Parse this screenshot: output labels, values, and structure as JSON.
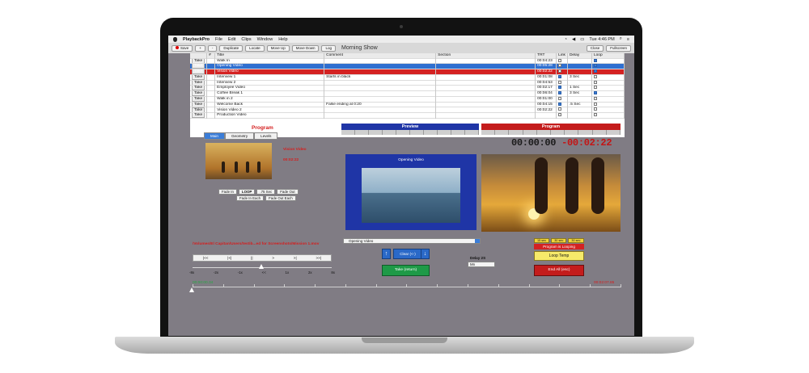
{
  "menubar": {
    "app": "PlaybackPro",
    "items": [
      "File",
      "Edit",
      "Clips",
      "Window",
      "Help"
    ],
    "clock": "Tue 4:46 PM"
  },
  "toolbar": {
    "save": "Save",
    "add": "+",
    "remove": "-",
    "duplicate": "Duplicate",
    "locate": "Locate",
    "move_up": "Move Up",
    "move_down": "Move Down",
    "log": "Log",
    "show_title": "Morning Show",
    "close": "Close",
    "fullscreen": "Fullscreen"
  },
  "table": {
    "headers": [
      "#",
      "Title",
      "Comment",
      "Section",
      "TRT",
      "Link",
      "Delay",
      "Loop"
    ],
    "rows": [
      {
        "take": "Take",
        "title": "Walk In",
        "comment": "",
        "trt": "00:04:23",
        "link": false,
        "delay": "",
        "loop": true,
        "state": ""
      },
      {
        "take": "Take",
        "title": "Opening Video",
        "comment": "",
        "trt": "00:05:28",
        "link": false,
        "delay": "",
        "loop": true,
        "state": "active"
      },
      {
        "take": "Take",
        "title": "Vision Video",
        "comment": "",
        "trt": "00:02:22",
        "link": false,
        "delay": "",
        "loop": true,
        "state": "red"
      },
      {
        "take": "Take",
        "title": "Interview 1",
        "comment": "Starts in black",
        "trt": "00:01:08",
        "link": true,
        "delay": "3 Sec",
        "loop": false,
        "state": ""
      },
      {
        "take": "Take",
        "title": "Interview 2",
        "comment": "",
        "trt": "00:04:53",
        "link": false,
        "delay": "",
        "loop": false,
        "state": ""
      },
      {
        "take": "Take",
        "title": "Employee Video",
        "comment": "",
        "trt": "00:02:17",
        "link": true,
        "delay": "1 Sec",
        "loop": false,
        "state": ""
      },
      {
        "take": "Take",
        "title": "Coffee Break 1",
        "comment": "",
        "trt": "00:06:04",
        "link": true,
        "delay": "3 Sec",
        "loop": true,
        "state": ""
      },
      {
        "take": "Take",
        "title": "Walk in 2",
        "comment": "",
        "trt": "00:01:00",
        "link": false,
        "delay": "",
        "loop": false,
        "state": ""
      },
      {
        "take": "Take",
        "title": "Welcome Back",
        "comment": "False ending at 0:20",
        "trt": "00:04:15",
        "link": true,
        "delay": ".5 Sec",
        "loop": false,
        "state": ""
      },
      {
        "take": "Take",
        "title": "Vision Video 2",
        "comment": "",
        "trt": "00:02:22",
        "link": false,
        "delay": "",
        "loop": false,
        "state": ""
      },
      {
        "take": "Take",
        "title": "Production Video",
        "comment": "",
        "trt": "",
        "link": false,
        "delay": "",
        "loop": false,
        "state": ""
      }
    ]
  },
  "left": {
    "title": "Program",
    "tabs": [
      "Main",
      "Geometry",
      "Levels"
    ],
    "clip_name": "Vision Video",
    "clip_time": "00:02:22",
    "fade_in": "Fade In",
    "loop": "LOOP",
    "loop_value": ".75 Sec",
    "fade_out": "Fade Out",
    "fade_in_each": "Fade In Each",
    "fade_out_each": "Fade Out Each",
    "path": "/Volumes/El Capitan/Users/testib...ed for Screenshots/Mission 1.mov",
    "transport": [
      "|<<",
      "|<|",
      "||",
      ">",
      ">|",
      ">>|"
    ],
    "speeds": [
      "-8x",
      "-2x",
      "-1x",
      "<<",
      "1x",
      "2x",
      "8x"
    ]
  },
  "preview": {
    "header": "Preview",
    "clip_label": "Opening Video",
    "selected": "Opening Video",
    "clear": "Clear (<-)",
    "take": "Take (return)",
    "delay_label": "Delay 2S",
    "delay_value": "Mn"
  },
  "program": {
    "header": "Program",
    "elapsed": "00:00:00",
    "remaining": "-00:02:22",
    "chips": [
      "15 sec",
      "30 sec",
      "30 sec"
    ],
    "looping": "Program is Looping",
    "loop_temp": "Loop Temp",
    "end_all": "End All (esc)"
  },
  "timeline": {
    "start": "00:00:00.34",
    "end": "00:02:07.85"
  }
}
